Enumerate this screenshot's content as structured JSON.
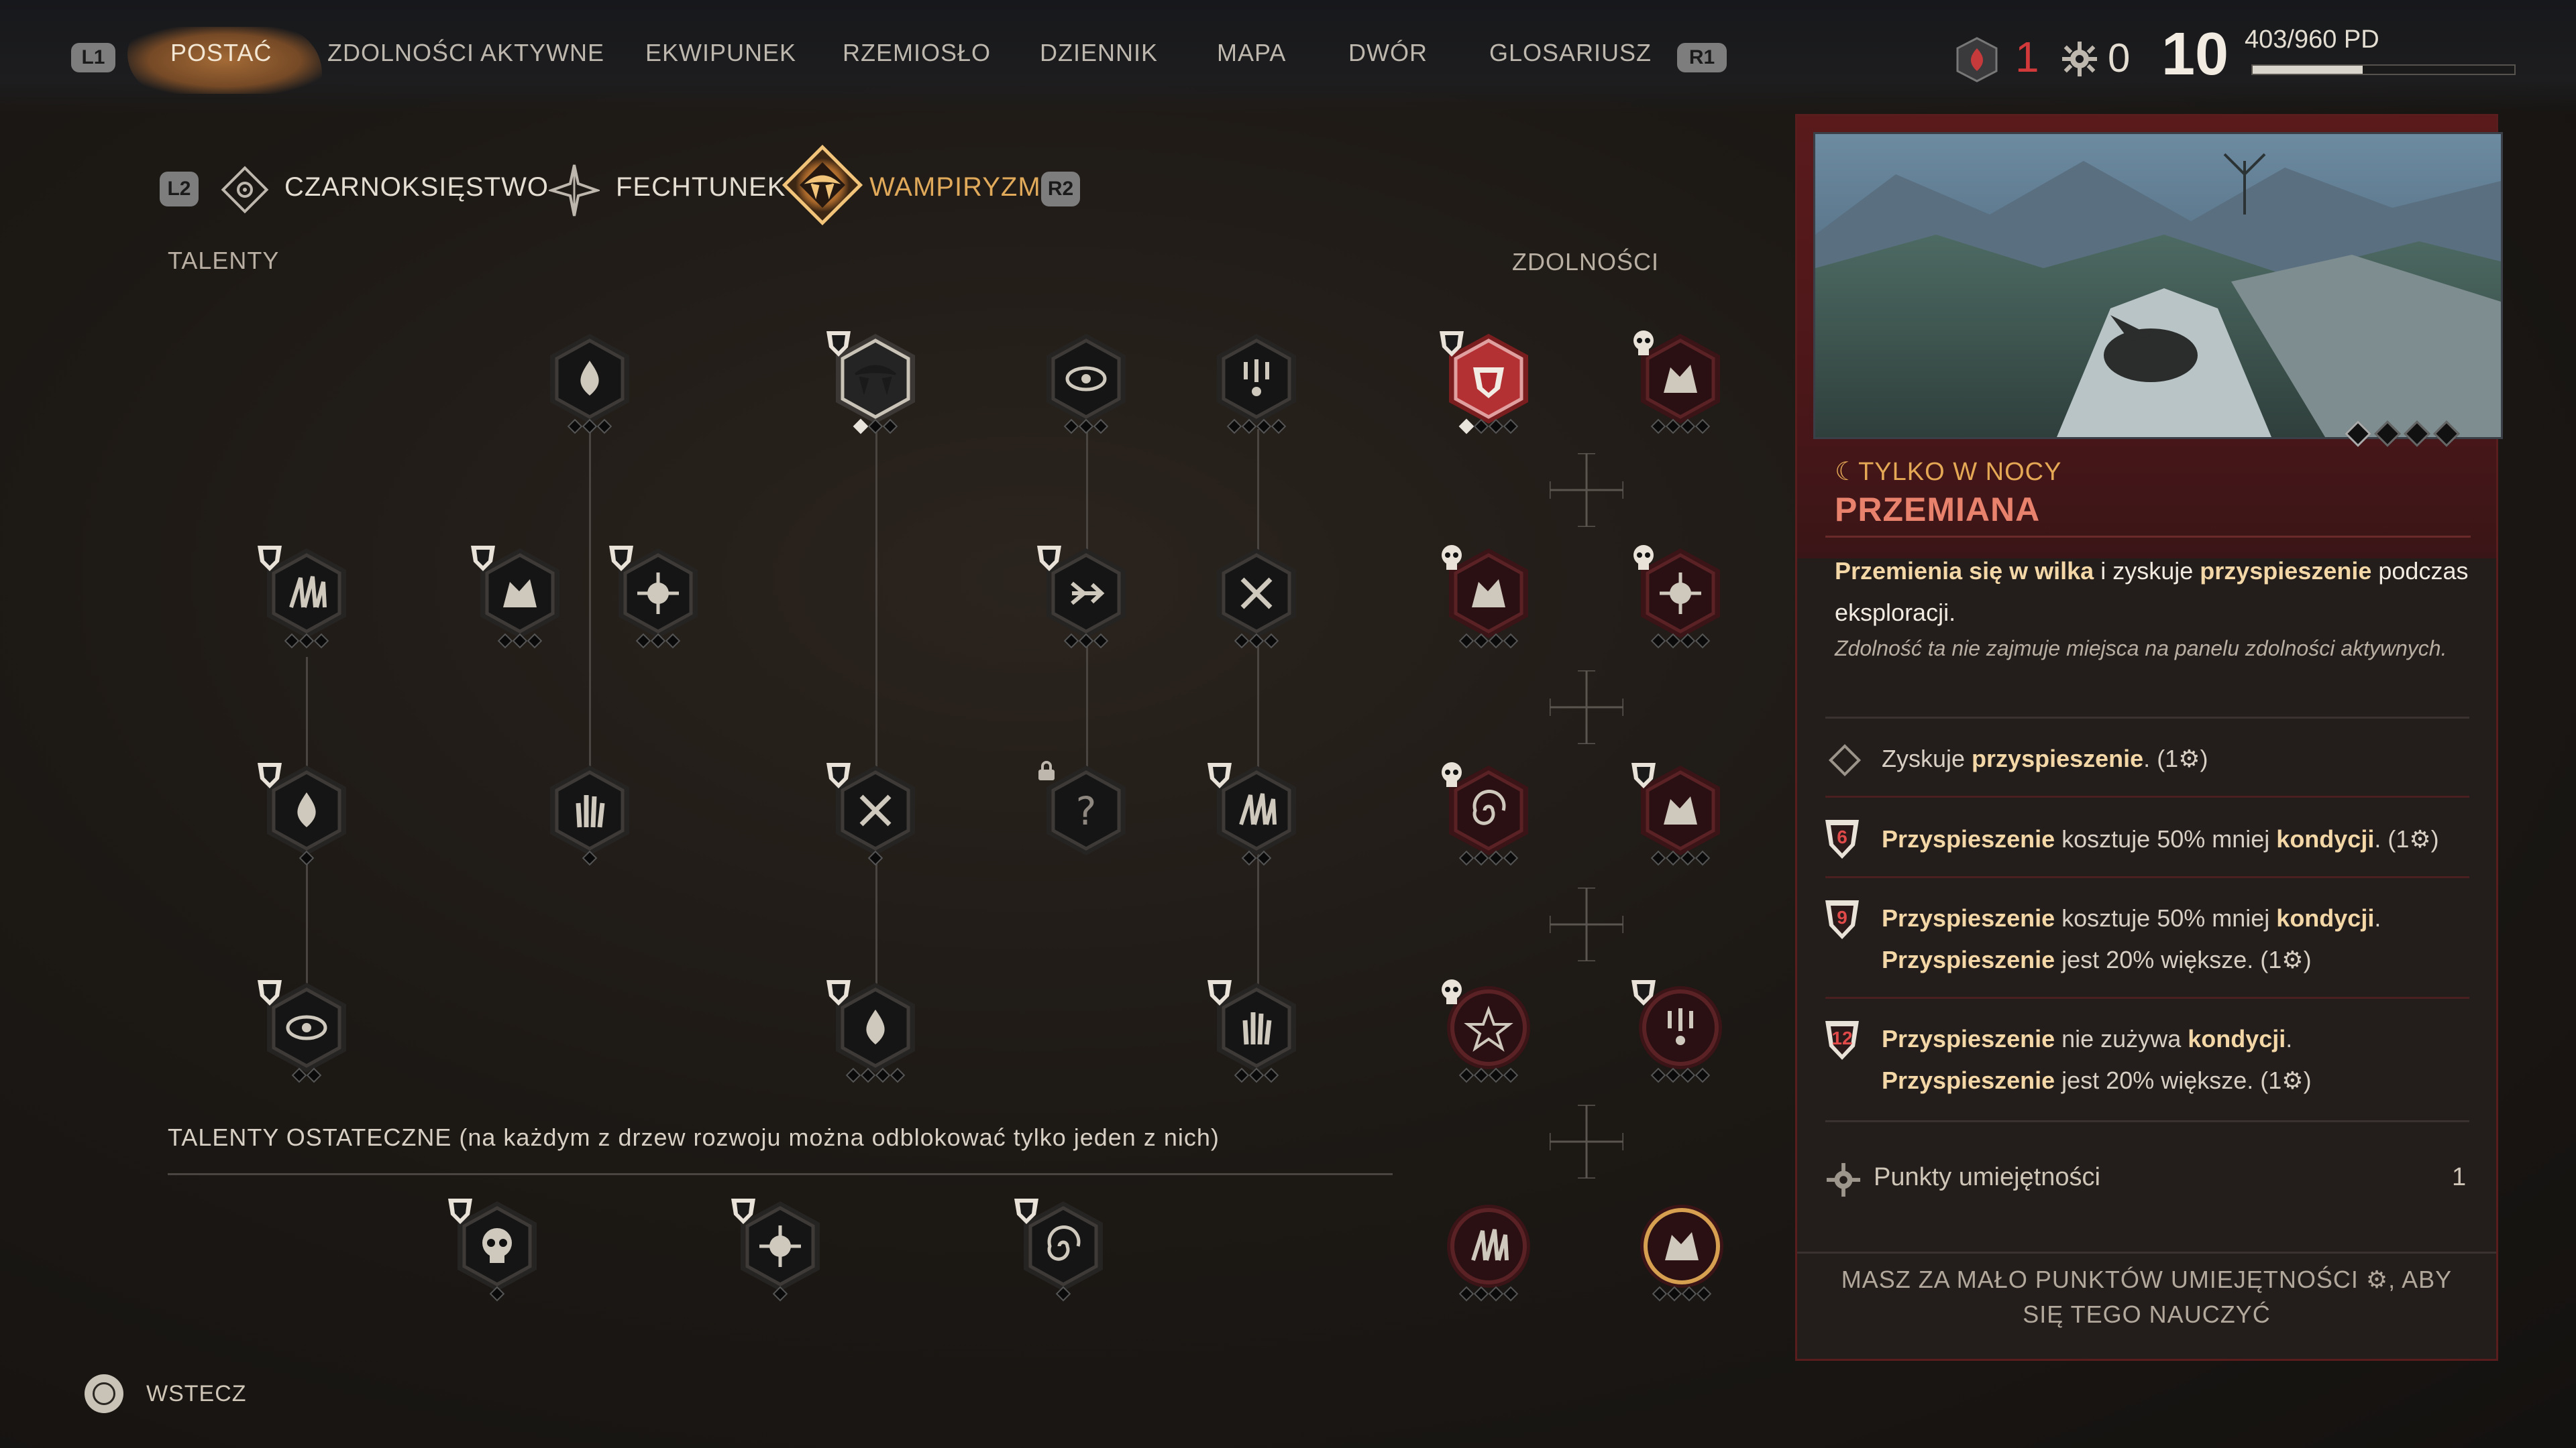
{
  "nav": {
    "left_badge": "L1",
    "right_badge": "R1",
    "tabs": [
      "POSTAĆ",
      "ZDOLNOŚCI AKTYWNE",
      "EKWIPUNEK",
      "RZEMIOSŁO",
      "DZIENNIK",
      "MAPA",
      "DWÓR",
      "GLOSARIUSZ"
    ],
    "active_tab": "POSTAĆ"
  },
  "status": {
    "red_points": "1",
    "skill_points": "0",
    "level": "10",
    "xp_text": "403/960 PD",
    "xp_fraction": 0.42
  },
  "subtabs": {
    "left_badge": "L2",
    "right_badge": "R2",
    "items": [
      "CZARNOKSIĘSTWO",
      "FECHTUNEK",
      "WAMPIRYZM"
    ],
    "active": "WAMPIRYZM"
  },
  "sections": {
    "talents": "TALENTY",
    "abilities": "ZDOLNOŚCI",
    "ultimate": "TALENTY OSTATECZNE (na każdym z drzew rozwoju można odblokować tylko jeden z nich)"
  },
  "detail": {
    "tag": "TYLKO W NOCY",
    "title": "PRZEMIANA",
    "desc_parts": [
      "Przemienia się w ",
      "wilka",
      " i zyskuje ",
      "przyspieszenie",
      " podczas eksploracji."
    ],
    "note": "Zdolność ta nie zajmuje miejsca na panelu zdolności aktywnych.",
    "upgrades": [
      {
        "level": "",
        "lines": [
          [
            "Zyskuje ",
            "przyspieszenie",
            ".",
            "  (1",
            ")"
          ]
        ]
      },
      {
        "level": "6",
        "lines": [
          [
            "",
            "Przyspieszenie",
            " kosztuje 50% mniej ",
            "kondycji",
            ".  (1",
            ")"
          ]
        ]
      },
      {
        "level": "9",
        "lines": [
          [
            "",
            "Przyspieszenie",
            " kosztuje 50% mniej ",
            "kondycji",
            "."
          ],
          [
            "",
            "Przyspieszenie",
            " jest 20% większe.  (1",
            ")"
          ]
        ]
      },
      {
        "level": "12",
        "lines": [
          [
            "",
            "Przyspieszenie",
            " nie zużywa ",
            "kondycji",
            "."
          ],
          [
            "",
            "Przyspieszenie",
            " jest 20% większe.  (1",
            ")"
          ]
        ]
      }
    ],
    "skill_points_label": "Punkty umiejętności",
    "skill_points_value": "1",
    "warning_line1": "MASZ ZA MAŁO PUNKTÓW UMIEJĘTNOŚCI",
    "warning_line1b": ", ABY",
    "warning_line2": "SIĘ TEGO NAUCZYĆ"
  },
  "footer": {
    "back_label": "WSTECZ"
  },
  "colors": {
    "accent_gold": "#e1a95a",
    "highlight": "#f4d7a6",
    "blood_red": "#c63a3c",
    "panel_red": "#5a1a1c"
  }
}
